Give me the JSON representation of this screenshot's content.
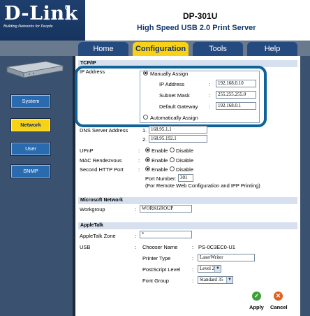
{
  "brand": {
    "logo": "D-Link",
    "tagline": "Building Networks for People"
  },
  "header": {
    "model": "DP-301U",
    "title": "High Speed USB 2.0 Print Server"
  },
  "tabs": [
    {
      "label": "Home"
    },
    {
      "label": "Configuration",
      "active": true
    },
    {
      "label": "Tools"
    },
    {
      "label": "Help"
    }
  ],
  "sidebar": {
    "items": [
      {
        "label": "System"
      },
      {
        "label": "Network",
        "active": true
      },
      {
        "label": "User"
      },
      {
        "label": "SNMP"
      }
    ]
  },
  "tcpip": {
    "heading": "TCP/IP",
    "ip_label": "IP Address",
    "manual_label": "Manually Assign",
    "ip_address_label": "IP Address",
    "ip_address": "192.168.0.10",
    "subnet_label": "Subnet Mask",
    "subnet": "255.255.255.0",
    "gateway_label": "Default Gateway",
    "gateway": "192.168.0.1",
    "auto_label": "Automatically Assign",
    "dns_label": "DNS Server Address",
    "dns1_prefix": "1.",
    "dns1": "168.95.1.1",
    "dns2_prefix": "2.",
    "dns2": "168.95.192.1",
    "upnp_label": "UPnP",
    "mac_label": "MAC Rendezvous",
    "second_http_label": "Second HTTP Port",
    "enable": "Enable",
    "disable": "Disable",
    "port_label": "Port Number",
    "port": "301",
    "port_note": "(For Remote Web Configuration and IPP Printing)"
  },
  "microsoft": {
    "heading": "Microsoft Network",
    "workgroup_label": "Workgroup",
    "workgroup": "WORKGROUP"
  },
  "appletalk": {
    "heading": "AppleTalk",
    "zone_label": "AppleTalk Zone",
    "zone": "*",
    "usb_label": "USB",
    "chooser_label": "Chooser Name",
    "chooser": "PS-0C3EC0-U1",
    "printer_type_label": "Printer Type",
    "printer_type": "LaserWriter",
    "postscript_label": "PostScript Level",
    "postscript": "Level 2",
    "font_label": "Font Group",
    "font": "Standard 35"
  },
  "actions": {
    "apply": "Apply",
    "cancel": "Cancel"
  },
  "colors": {
    "accent": "#f7d216",
    "nav": "#244a80",
    "highlight": "#10629a"
  }
}
